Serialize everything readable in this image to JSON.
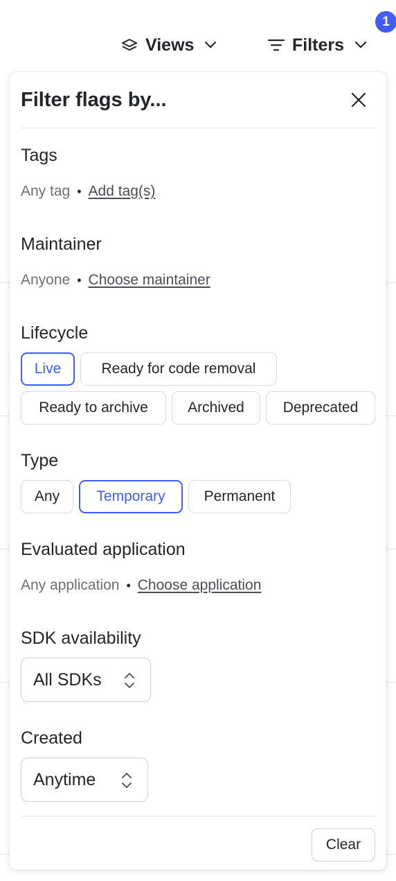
{
  "toolbar": {
    "views_label": "Views",
    "filters_label": "Filters",
    "filters_badge": "1"
  },
  "popover": {
    "title": "Filter flags by...",
    "tags": {
      "title": "Tags",
      "value": "Any tag",
      "link": "Add tag(s)"
    },
    "maintainer": {
      "title": "Maintainer",
      "value": "Anyone",
      "link": "Choose maintainer"
    },
    "lifecycle": {
      "title": "Lifecycle",
      "options": [
        "Live",
        "Ready for code removal",
        "Ready to archive",
        "Archived",
        "Deprecated"
      ],
      "selected": "Live"
    },
    "type": {
      "title": "Type",
      "options": [
        "Any",
        "Temporary",
        "Permanent"
      ],
      "selected": "Temporary"
    },
    "evaluated_application": {
      "title": "Evaluated application",
      "value": "Any application",
      "link": "Choose application"
    },
    "sdk_availability": {
      "title": "SDK availability",
      "selected": "All SDKs"
    },
    "created": {
      "title": "Created",
      "selected": "Anytime"
    },
    "clear_label": "Clear"
  },
  "colors": {
    "accent": "#405bff",
    "text": "#23252b",
    "muted": "#6b6e78",
    "border": "#d9dadf"
  }
}
